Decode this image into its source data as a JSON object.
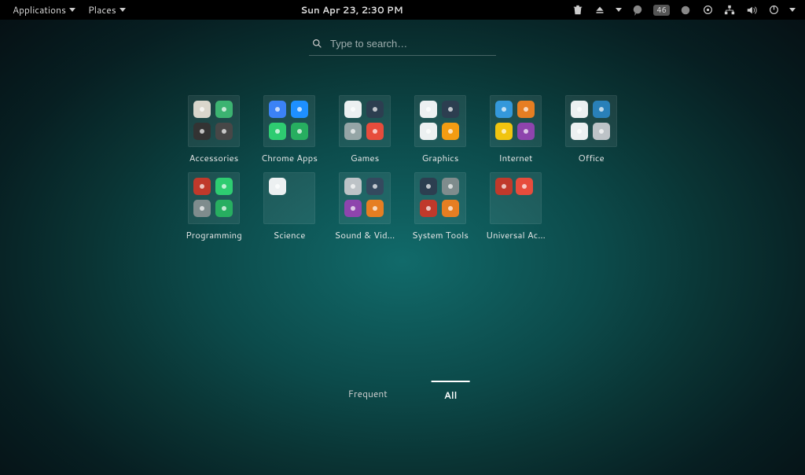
{
  "panel": {
    "applications_label": "Applications",
    "places_label": "Places",
    "clock": "Sun Apr 23,  2:30 PM",
    "battery_badge": "46"
  },
  "search": {
    "placeholder": "Type to search…"
  },
  "folders": [
    {
      "label": "Accessories",
      "icons": [
        "printer",
        "cd-burn",
        "terminal",
        "calculator"
      ]
    },
    {
      "label": "Chrome Apps",
      "icons": [
        "chrome-store",
        "camera",
        "hangouts",
        "hangouts-alt"
      ]
    },
    {
      "label": "Games",
      "icons": [
        "cards",
        "chess",
        "robots",
        "colors"
      ]
    },
    {
      "label": "Graphics",
      "icons": [
        "doc-viewer",
        "screenshot",
        "doc-viewer-alt",
        "image-viewer"
      ]
    },
    {
      "label": "Internet",
      "icons": [
        "chromium",
        "firefox",
        "chrome",
        "pidgin"
      ]
    },
    {
      "label": "Office",
      "icons": [
        "doc-viewer",
        "addressbook",
        "dictionary",
        "tasks"
      ]
    },
    {
      "label": "Programming",
      "icons": [
        "meld",
        "android-studio",
        "anjuta",
        "emacs"
      ]
    },
    {
      "label": "Science",
      "icons": [
        "document"
      ]
    },
    {
      "label": "Sound & Vid…",
      "icons": [
        "disc",
        "movie",
        "sound-juicer",
        "clapper"
      ]
    },
    {
      "label": "System Tools",
      "icons": [
        "boxes",
        "tweaks",
        "disks",
        "software"
      ]
    },
    {
      "label": "Universal Ac…",
      "icons": [
        "orca",
        "cherry"
      ]
    }
  ],
  "icon_colors": {
    "printer": "#d9d6cc",
    "cd-burn": "#3cb371",
    "terminal": "#333",
    "calculator": "#474747",
    "chrome-store": "#3b82f6",
    "camera": "#1e90ff",
    "hangouts": "#2ecc71",
    "hangouts-alt": "#27ae60",
    "cards": "#ecf0f1",
    "chess": "#2c3e50",
    "robots": "#95a5a6",
    "colors": "#e74c3c",
    "doc-viewer": "#ecf0f1",
    "screenshot": "#2c3e50",
    "doc-viewer-alt": "#ecf0f1",
    "image-viewer": "#f39c12",
    "chromium": "#3498db",
    "firefox": "#e67e22",
    "chrome": "#f1c40f",
    "pidgin": "#8e44ad",
    "addressbook": "#2980b9",
    "dictionary": "#ecf0f1",
    "tasks": "#bdc3c7",
    "meld": "#c0392b",
    "android-studio": "#2ecc71",
    "anjuta": "#7f8c8d",
    "emacs": "#27ae60",
    "document": "#ecf0f1",
    "disc": "#bdc3c7",
    "movie": "#34495e",
    "sound-juicer": "#8e44ad",
    "clapper": "#e67e22",
    "boxes": "#2c3e50",
    "tweaks": "#7f8c8d",
    "disks": "#c0392b",
    "software": "#e67e22",
    "orca": "#c0392b",
    "cherry": "#e74c3c"
  },
  "tabs": {
    "frequent": "Frequent",
    "all": "All",
    "active": "all"
  }
}
